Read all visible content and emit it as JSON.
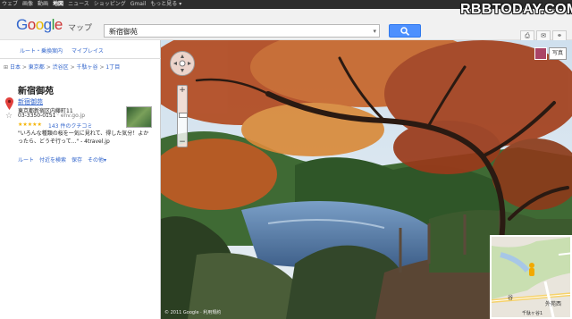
{
  "topnav": [
    "ウェブ",
    "画像",
    "動画",
    "地図",
    "ニュース",
    "ショッピング",
    "Gmail",
    "もっと見る ▾"
  ],
  "topnav_active": 3,
  "logo": {
    "text": "Google",
    "sub": "マップ"
  },
  "search": {
    "value": "新宿御苑"
  },
  "watermark": "RBBTODAY.COM",
  "left": {
    "tabs": [
      "ルート・乗換案内",
      "マイプレイス"
    ],
    "breadcrumb": [
      "日本",
      "東京都",
      "渋谷区",
      "千駄ヶ谷",
      "1丁目"
    ],
    "title": "新宿御苑",
    "result": {
      "name": "新宿御苑",
      "address": "東京都新宿区内藤町11",
      "phone": "03-3350-0151",
      "site": "· env.go.jp",
      "stars": "★★★★★",
      "reviews": "143 件のクチコミ",
      "snippet": "\"いろんな種類の桜を一気に見れて、得した気分！よかったら、どうぞ行って...\" - 4travel.jp"
    },
    "actions": [
      "ルート",
      "付近を検索",
      "保存",
      "その他▾"
    ]
  },
  "streetview": {
    "photo_label": "写真",
    "credit": "© 2011 Google · 利用規約"
  },
  "minimap": {
    "label1": "谷",
    "label2": "外苑西",
    "label3": "千駄ヶ谷1"
  },
  "colors": {
    "accent": "#4d90fe",
    "link": "#3366cc",
    "topbar": "#2d2d2d"
  }
}
